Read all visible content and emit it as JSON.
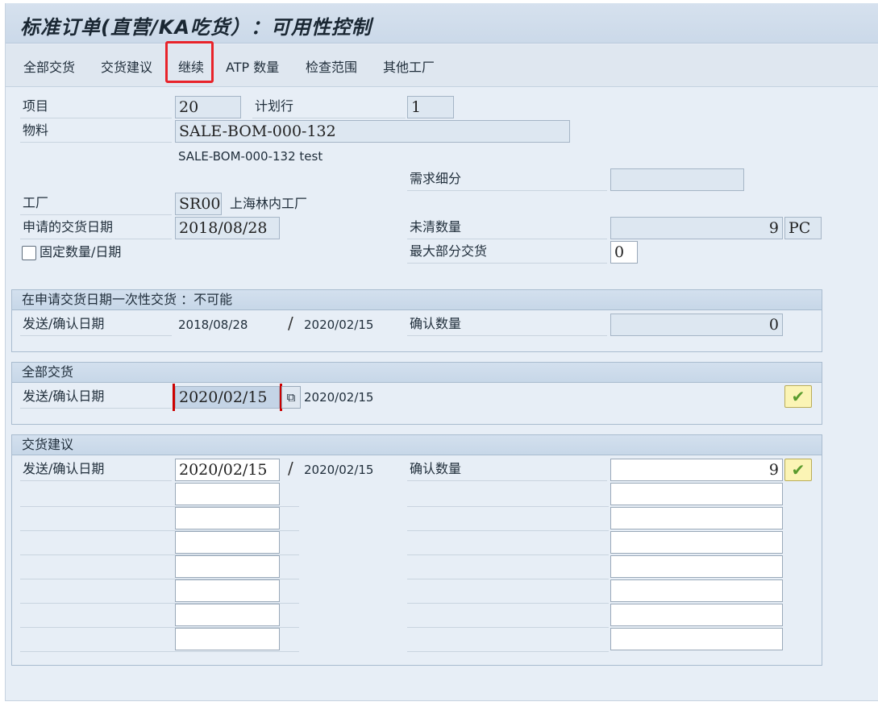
{
  "title": "标准订单(直营/KA吃货）：可用性控制",
  "toolbar": {
    "all_delivery": "全部交货",
    "delivery_proposal": "交货建议",
    "continue": "继续",
    "atp_qty": "ATP 数量",
    "check_scope": "检查范围",
    "other_plants": "其他工厂"
  },
  "header": {
    "item_label": "项目",
    "item_value": "20",
    "schedule_line_label": "计划行",
    "schedule_line_value": "1",
    "material_label": "物料",
    "material_value": "SALE-BOM-000-132",
    "material_desc": "SALE-BOM-000-132 test",
    "req_segment_label": "需求细分",
    "req_segment_value": "",
    "plant_label": "工厂",
    "plant_value": "SR00",
    "plant_name": "上海林内工厂",
    "req_date_label": "申请的交货日期",
    "req_date_value": "2018/08/28",
    "open_qty_label": "未清数量",
    "open_qty_value": "9",
    "unit": "PC",
    "fixed_label": "固定数量/日期",
    "max_part_label": "最大部分交货",
    "max_part_value": "0"
  },
  "one_time": {
    "title": "在申请交货日期一次性交货 ：不可能",
    "date_label": "发送/确认日期",
    "date1": "2018/08/28",
    "date2": "2020/02/15",
    "confirm_label": "确认数量",
    "confirm_value": "0"
  },
  "complete": {
    "title": "全部交货",
    "date_label": "发送/确认日期",
    "date1": "2020/02/15",
    "date2": "2020/02/15",
    "check_icon": "checkmark-icon"
  },
  "proposal": {
    "title": "交货建议",
    "date_label": "发送/确认日期",
    "date1": "2020/02/15",
    "date2": "2020/02/15",
    "confirm_label": "确认数量",
    "confirm_value": "9"
  },
  "colors": {
    "highlight": "#e8232a",
    "check": "#5a9b2e"
  }
}
